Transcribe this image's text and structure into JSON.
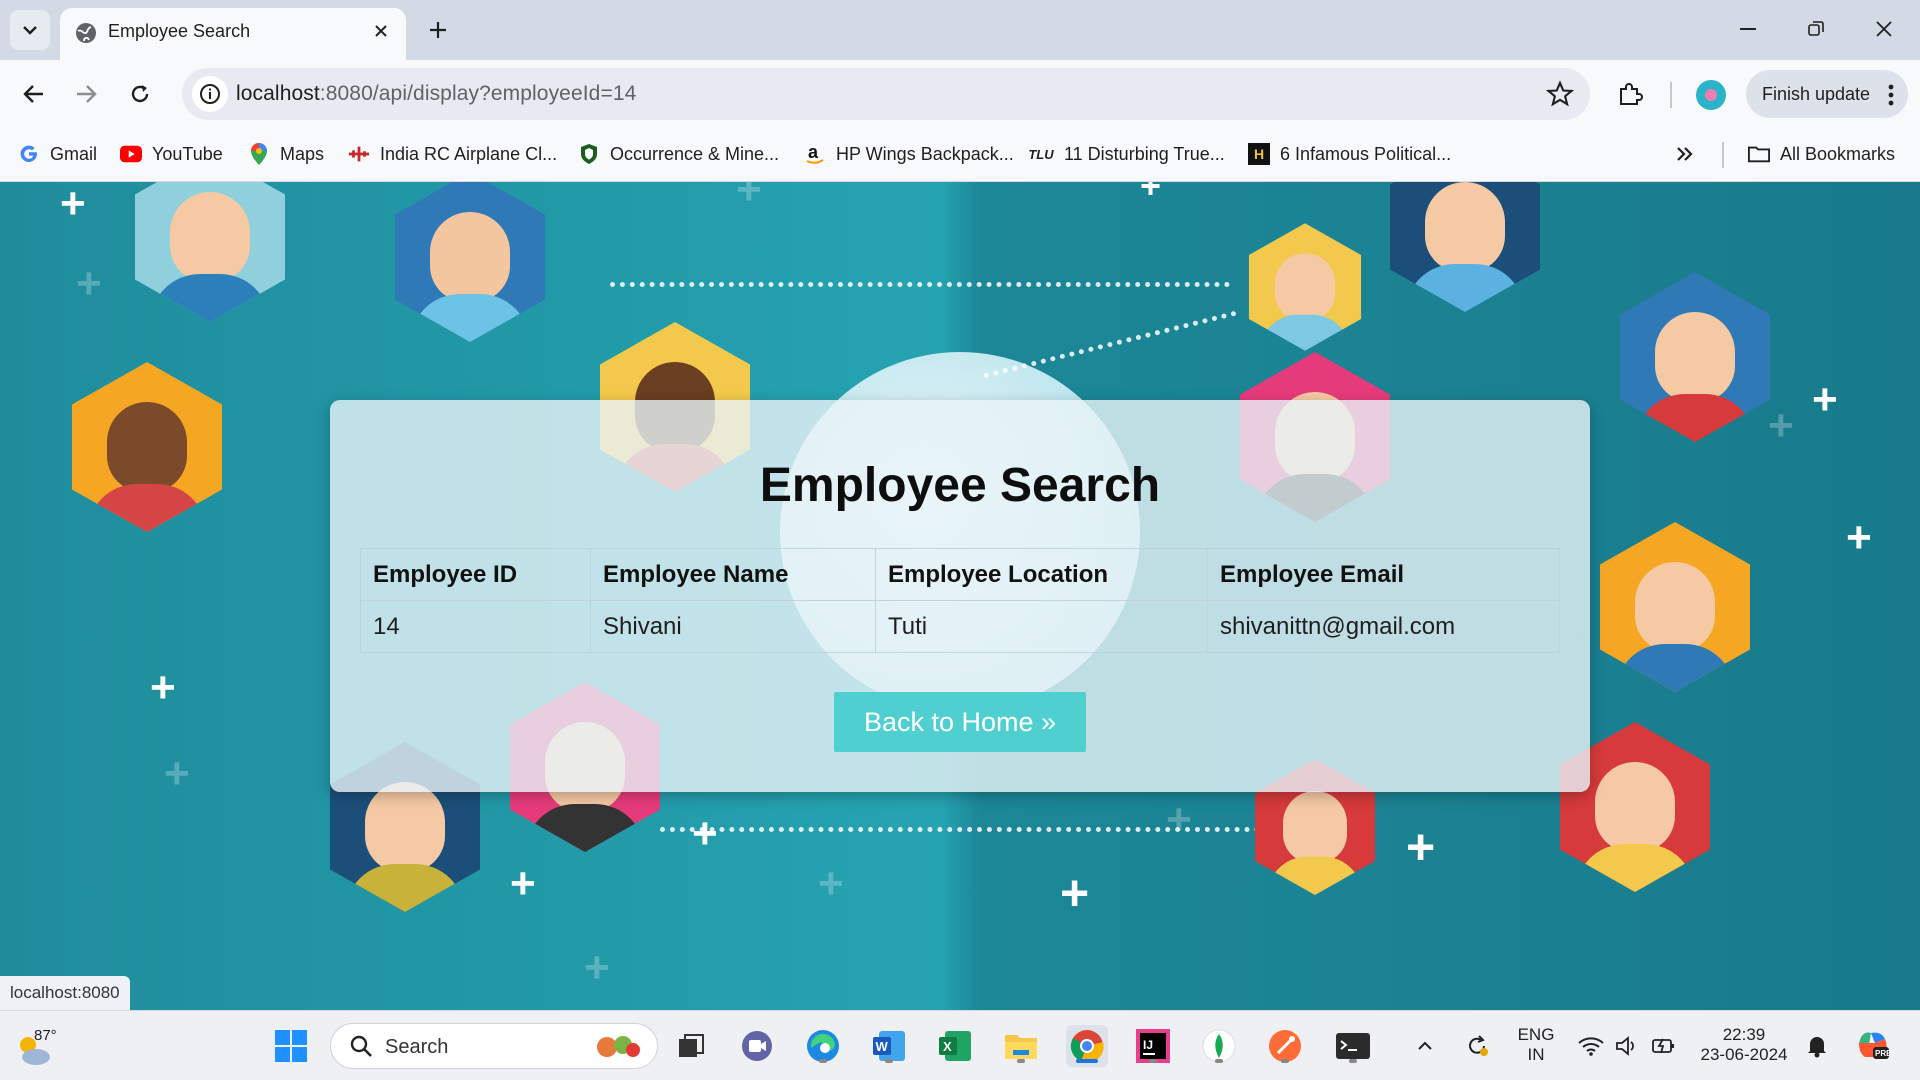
{
  "browser": {
    "tab_title": "Employee Search",
    "url_host": "localhost",
    "url_rest": ":8080/api/display?employeeId=14",
    "finish_update_label": "Finish update",
    "status_url": "localhost:8080"
  },
  "bookmarks": [
    {
      "label": "Gmail",
      "icon": "gmail-icon"
    },
    {
      "label": "YouTube",
      "icon": "youtube-icon"
    },
    {
      "label": "Maps",
      "icon": "maps-icon"
    },
    {
      "label": "India RC Airplane Cl...",
      "icon": "airplane-icon"
    },
    {
      "label": "Occurrence & Mine...",
      "icon": "shield-icon"
    },
    {
      "label": "HP Wings Backpack...",
      "icon": "amazon-icon"
    },
    {
      "label": "11 Disturbing True...",
      "icon": "tlu-icon",
      "icon_text": "TLU"
    },
    {
      "label": "6 Infamous Political...",
      "icon": "history-icon",
      "icon_text": "H"
    }
  ],
  "all_bookmarks_label": "All Bookmarks",
  "page": {
    "heading": "Employee Search",
    "table": {
      "headers": [
        "Employee ID",
        "Employee Name",
        "Employee Location",
        "Employee Email"
      ],
      "rows": [
        [
          "14",
          "Shivani",
          "Tuti",
          "shivanittn@gmail.com"
        ]
      ]
    },
    "back_button_label": "Back to Home »"
  },
  "taskbar": {
    "temperature": "87°",
    "search_placeholder": "Search",
    "lang_top": "ENG",
    "lang_bottom": "IN",
    "time": "22:39",
    "date": "23-06-2024"
  },
  "colors": {
    "background_teal": "#229aa8",
    "button_teal": "#4fcfcf",
    "card_bg": "#e9f4f7"
  }
}
